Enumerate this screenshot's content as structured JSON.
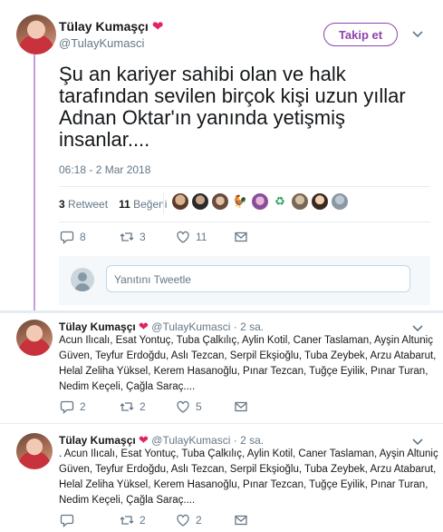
{
  "main": {
    "author_name": "Tülay Kumaşçı",
    "author_heart": "❤",
    "author_handle": "@TulayKumasci",
    "follow_label": "Takip et",
    "text": "Şu an kariyer sahibi olan ve halk tarafından sevilen birçok kişi uzun yıllar Adnan Oktar'ın yanında yetişmiş insanlar....",
    "time": "06:18 - 2 Mar 2018",
    "retweet_count": "3",
    "retweet_label": "Retweet",
    "like_count": "11",
    "like_label": "Beğeni",
    "actions": {
      "reply": "8",
      "retweet": "3",
      "like": "11"
    },
    "reply_placeholder": "Yanıtını Tweetle",
    "liker_faces": [
      "face-1",
      "face-2",
      "face-3",
      "face-4",
      "face-5",
      "face-6",
      "face-7",
      "face-8",
      "face-9"
    ]
  },
  "replies": [
    {
      "author_name": "Tülay Kumaşçı",
      "author_heart": "❤",
      "author_handle": "@TulayKumasci",
      "dot": "·",
      "time": "2 sa.",
      "lines": [
        "Acun Ilıcalı, Esat Yontuç, Tuba Çalkılıç, Aylin Kotil, Caner Taslaman, Ayşin Altuniç",
        "Güven, Teyfur Erdoğdu, Aslı Tezcan, Serpil Ekşioğlu, Tuba Zeybek, Arzu Atabarut,",
        "Helal Zeliha Yüksel, Kerem Hasanoğlu, Pınar Tezcan, Tuğçe Eyilik, Pınar Turan,",
        "Nedim Keçeli, Çağla Saraç...."
      ],
      "actions": {
        "reply": "2",
        "retweet": "2",
        "like": "5"
      }
    },
    {
      "author_name": "Tülay Kumaşçı",
      "author_heart": "❤",
      "author_handle": "@TulayKumasci",
      "dot": "·",
      "time": "2 sa.",
      "lines": [
        ". Acun Ilıcalı, Esat Yontuç, Tuba Çalkılıç, Aylin Kotil, Caner Taslaman,  Ayşin Altuniç",
        "Güven, Teyfur Erdoğdu, Aslı Tezcan, Serpil Ekşioğlu, Tuba  Zeybek, Arzu Atabarut,",
        "Helal Zeliha Yüksel, Kerem Hasanoğlu, Pınar  Tezcan, Tuğçe Eyilik, Pınar Turan,",
        "Nedim Keçeli, Çağla Saraç...."
      ],
      "actions": {
        "reply": "",
        "retweet": "2",
        "like": "2"
      }
    }
  ],
  "colors": {
    "accent": "#8e44ad",
    "heart": "#e0245e",
    "thread": "#c79be0",
    "muted": "#657786"
  }
}
